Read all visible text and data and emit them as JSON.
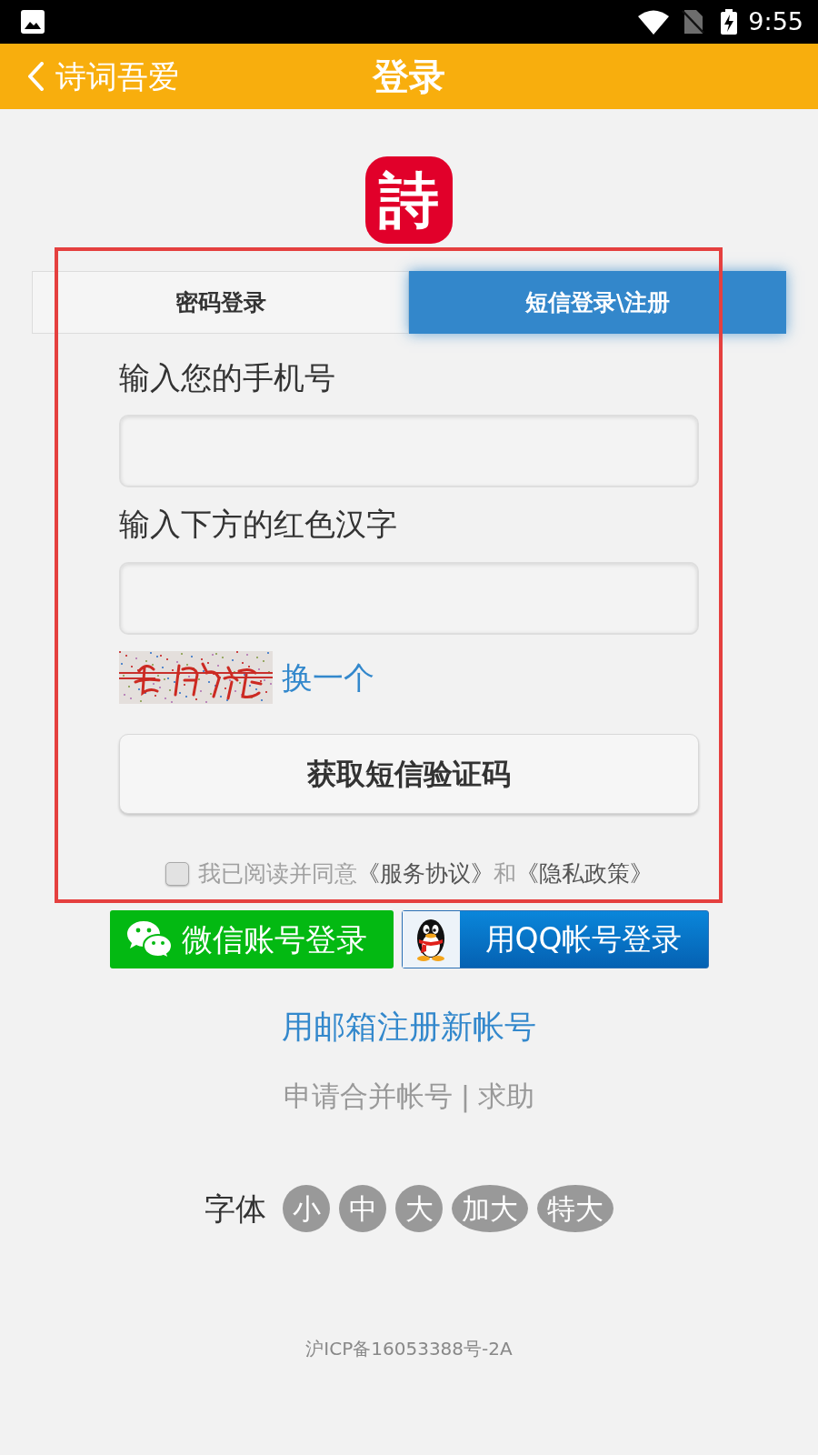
{
  "status_bar": {
    "time": "9:55"
  },
  "app_bar": {
    "back_label": "诗词吾爱",
    "title": "登录"
  },
  "logo": {
    "text": "詩"
  },
  "tabs": [
    {
      "label": "密码登录",
      "selected": false
    },
    {
      "label": "短信登录\\注册",
      "selected": true
    }
  ],
  "form": {
    "fields": [
      {
        "label": "输入您的手机号"
      },
      {
        "label": "输入下方的红色汉字"
      }
    ],
    "captcha_refresh": "换一个",
    "submit_button": "获取短信验证码",
    "agreement": {
      "checked": false,
      "text": "我已阅读并同意",
      "terms_link": "《服务协议》",
      "conjunction": "和",
      "privacy_link": "《隐私政策》"
    }
  },
  "social_logins": [
    {
      "kind": "wechat",
      "label": "微信账号登录"
    },
    {
      "kind": "qq",
      "label": "用QQ帐号登录"
    }
  ],
  "email_register": "用邮箱注册新帐号",
  "help_links": {
    "items": [
      "申请合并帐号",
      "求助"
    ],
    "separator": "|"
  },
  "font_size": {
    "label": "字体",
    "options": [
      {
        "label": "小",
        "selected": false
      },
      {
        "label": "中",
        "selected": false
      },
      {
        "label": "大",
        "selected": false
      },
      {
        "label": "加大",
        "selected": false
      },
      {
        "label": "特大",
        "selected": false
      }
    ]
  },
  "footer": {
    "icp": "沪ICP备16053388号-2A"
  }
}
